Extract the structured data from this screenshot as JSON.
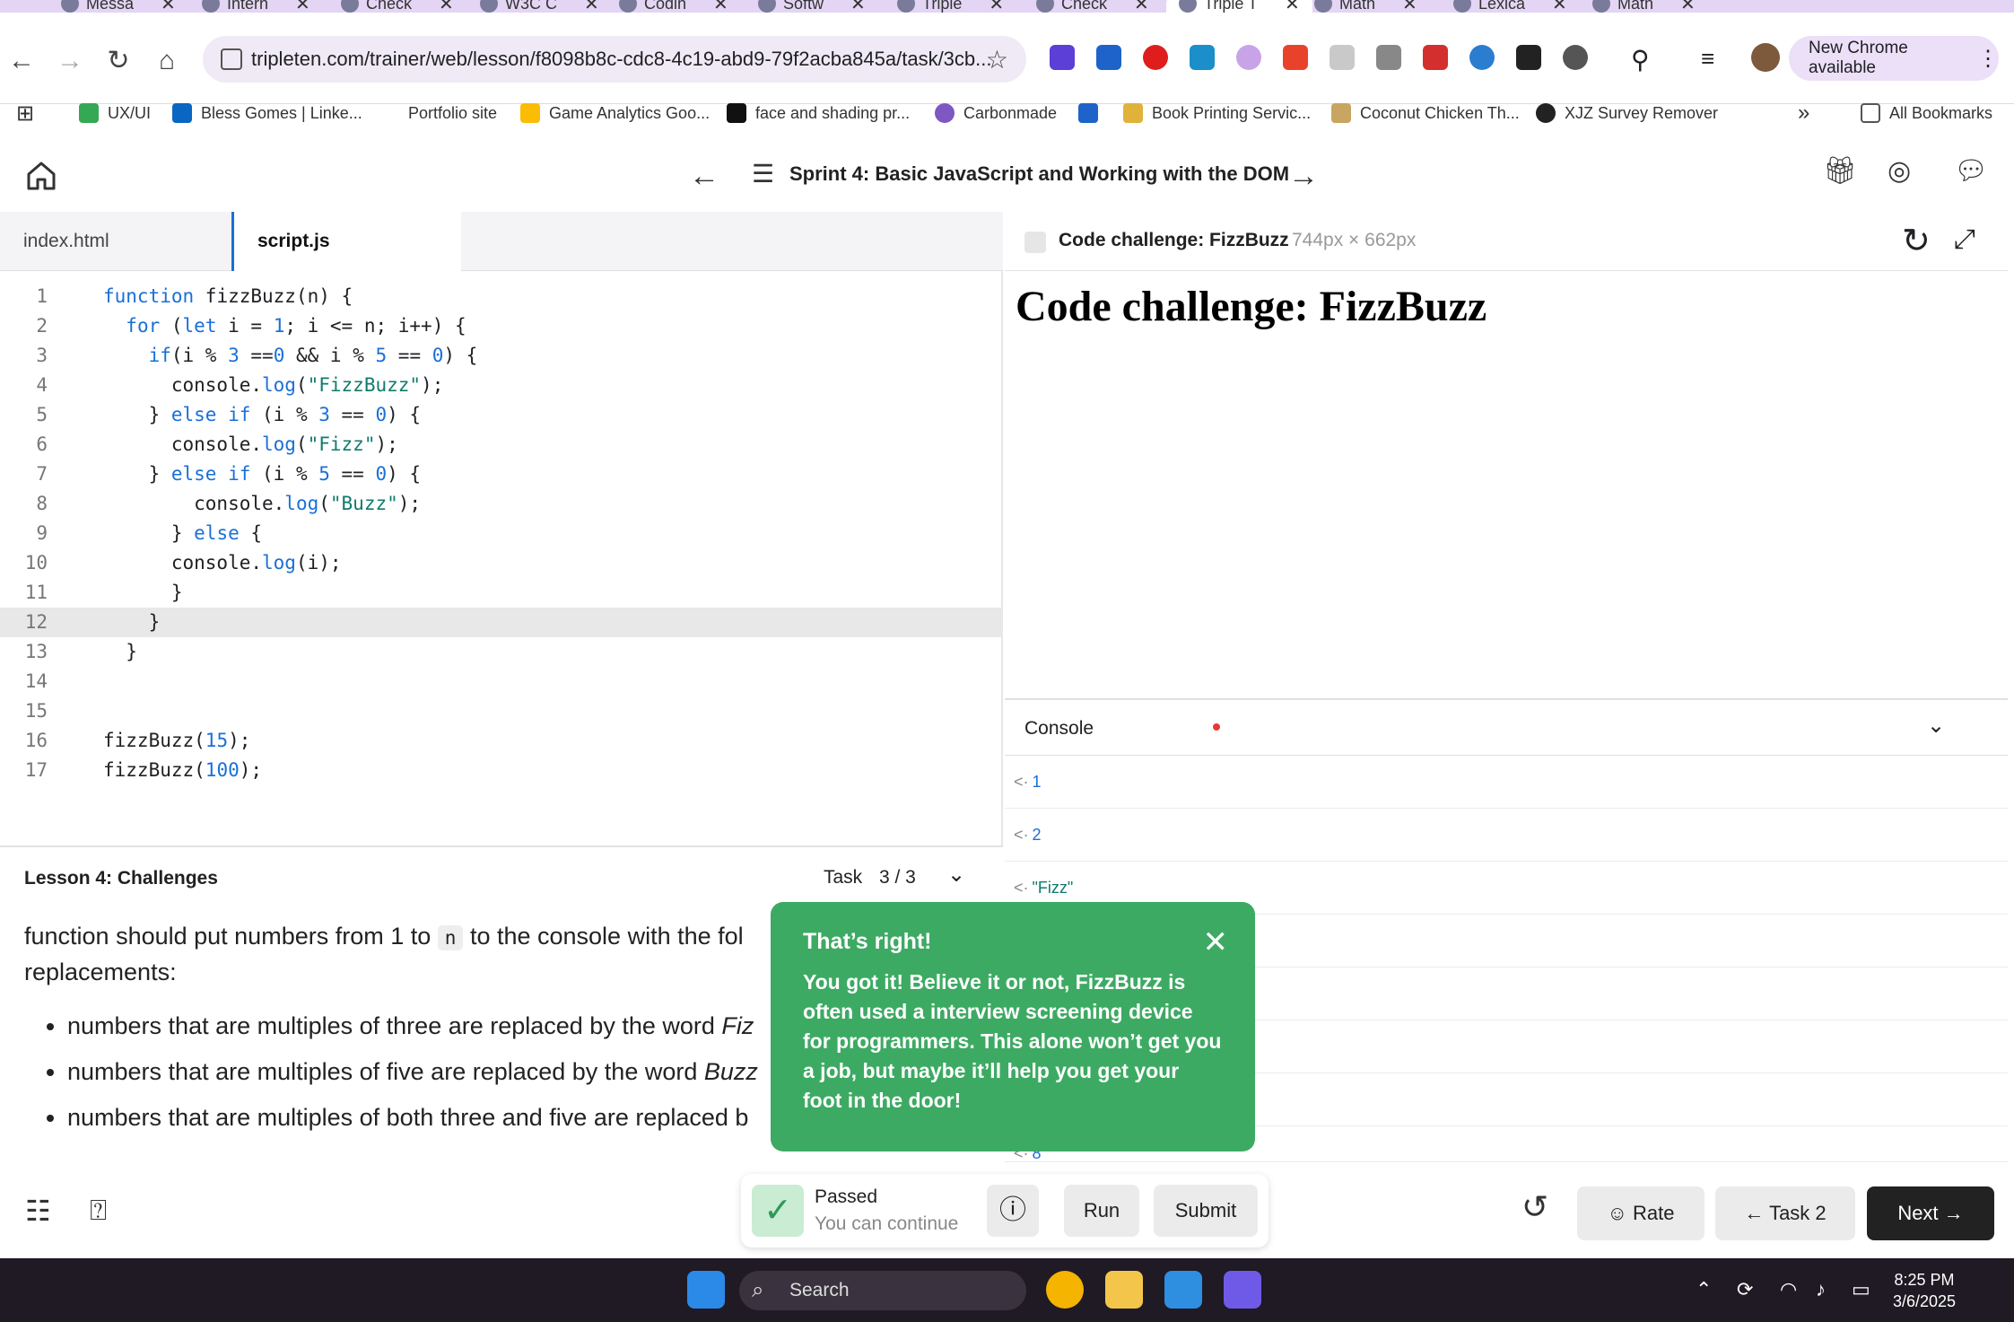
{
  "browser": {
    "tabs": [
      "Messa",
      "Intern",
      "Check",
      "W3C C",
      "Codin",
      "Softw",
      "Triple",
      "Check",
      "Triple T",
      "Math",
      "Lexica",
      "Math"
    ],
    "url": "tripleten.com/trainer/web/lesson/f8098b8c-cdc8-4c19-abd9-79f2acba845a/task/3cb...",
    "new_chrome": "New Chrome available",
    "bookmarks": [
      "UX/UI",
      "Bless Gomes | Linke...",
      "Portfolio site",
      "Game Analytics Goo...",
      "face and shading pr...",
      "Carbonmade",
      "Book Printing Servic...",
      "Coconut Chicken Th...",
      "XJZ Survey Remover"
    ],
    "all_bookmarks": "All Bookmarks",
    "more": "»"
  },
  "header": {
    "title": "Sprint 4: Basic JavaScript and Working with the DOM"
  },
  "editor": {
    "tabs": [
      "index.html",
      "script.js"
    ],
    "lines": [
      {
        "n": "1",
        "code": "function fizzBuzz(n) {"
      },
      {
        "n": "2",
        "code": "  for (let i = 1; i <= n; i++) {"
      },
      {
        "n": "3",
        "code": "    if(i % 3 ==0 && i % 5 == 0) {"
      },
      {
        "n": "4",
        "code": "      console.log(\"FizzBuzz\");"
      },
      {
        "n": "5",
        "code": "    } else if (i % 3 == 0) {"
      },
      {
        "n": "6",
        "code": "      console.log(\"Fizz\");"
      },
      {
        "n": "7",
        "code": "    } else if (i % 5 == 0) {"
      },
      {
        "n": "8",
        "code": "        console.log(\"Buzz\");"
      },
      {
        "n": "9",
        "code": "      } else {"
      },
      {
        "n": "10",
        "code": "      console.log(i);"
      },
      {
        "n": "11",
        "code": "      }"
      },
      {
        "n": "12",
        "code": "    }"
      },
      {
        "n": "13",
        "code": "  }"
      },
      {
        "n": "14",
        "code": ""
      },
      {
        "n": "15",
        "code": ""
      },
      {
        "n": "16",
        "code": "fizzBuzz(15);"
      },
      {
        "n": "17",
        "code": "fizzBuzz(100);"
      }
    ],
    "highlight_line": "12"
  },
  "lesson": {
    "name": "Lesson 4: Challenges",
    "task_label": "Task",
    "task_count": "3 / 3",
    "intro_a": "function should put numbers from 1 to",
    "intro_code": "n",
    "intro_b": "to the console with the fol",
    "intro_c": "replacements:",
    "bullets": [
      {
        "text": "numbers that are multiples of three are replaced by the word",
        "em": "Fiz"
      },
      {
        "text": "numbers that are multiples of five are replaced by the word",
        "em": "Buzz"
      },
      {
        "text": "numbers that are multiples of both three and five are replaced b",
        "em": ""
      }
    ]
  },
  "preview": {
    "title": "Code challenge: FizzBuzz",
    "size": "744px × 662px",
    "heading": "Code challenge: FizzBuzz"
  },
  "console": {
    "title": "Console",
    "rows": [
      {
        "value": "1",
        "type": "num"
      },
      {
        "value": "2",
        "type": "num"
      },
      {
        "value": "\"Fizz\"",
        "type": "str"
      },
      {
        "value": "",
        "type": "num"
      },
      {
        "value": "",
        "type": "num"
      },
      {
        "value": "",
        "type": "num"
      },
      {
        "value": "",
        "type": "num"
      },
      {
        "value": "8",
        "type": "num"
      }
    ]
  },
  "toast": {
    "title": "That’s right!",
    "body": "You got it! Believe it or not, FizzBuzz is often used a interview screening device for programmers. This alone won’t get you a job, but maybe it’ll help you get your foot in the door!"
  },
  "bottom": {
    "status_title": "Passed",
    "status_sub": "You can continue",
    "run": "Run",
    "submit": "Submit",
    "rate": "Rate",
    "prev_task": "Task 2",
    "next": "Next"
  },
  "taskbar": {
    "search": "Search",
    "time": "8:25 PM",
    "date": "3/6/2025"
  },
  "colors": {
    "accent": "#1a6fd8",
    "success": "#3daa63",
    "string": "#0f7b6c"
  }
}
